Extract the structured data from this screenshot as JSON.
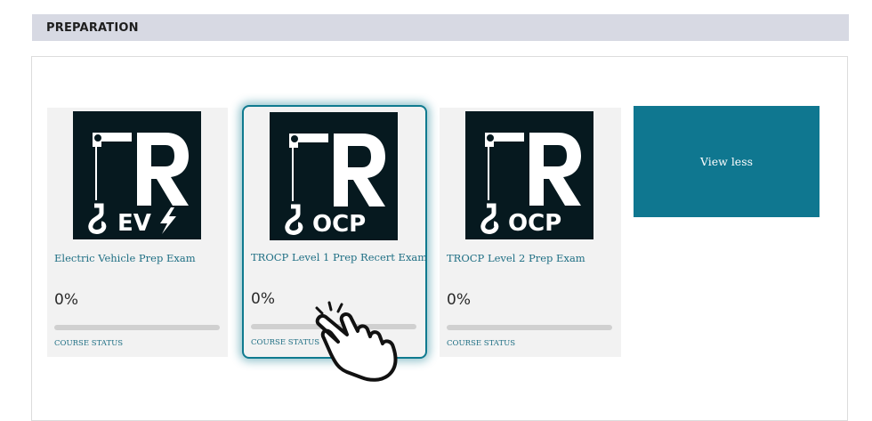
{
  "section": {
    "title": "PREPARATION"
  },
  "courses": [
    {
      "title": "Electric Vehicle Prep Exam",
      "progress": "0%",
      "progress_value": 0,
      "status_label": "COURSE STATUS",
      "logo": {
        "brand": "R",
        "badge": "EV"
      }
    },
    {
      "title": "TROCP Level 1 Prep Recert Exam",
      "progress": "0%",
      "progress_value": 0,
      "status_label": "COURSE STATUS",
      "logo": {
        "brand": "R",
        "badge": "OCP"
      }
    },
    {
      "title": "TROCP Level 2 Prep Exam",
      "progress": "0%",
      "progress_value": 0,
      "status_label": "COURSE STATUS",
      "logo": {
        "brand": "R",
        "badge": "OCP"
      }
    }
  ],
  "actions": {
    "view_less": "View less"
  },
  "icons": {
    "crane_hook": "crane-hook-icon",
    "lightning": "lightning-bolt-icon",
    "cursor": "hand-pointer-icon"
  },
  "colors": {
    "accent": "#0f7790",
    "header_bg": "#d7d9e3",
    "logo_bg": "#06191f"
  }
}
